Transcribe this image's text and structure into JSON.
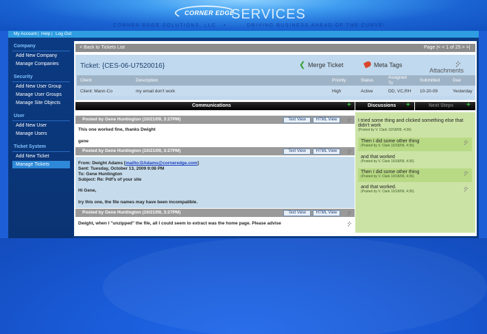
{
  "header": {
    "logo_small": "CORNER EDGE",
    "logo_big": "SERVICES",
    "tagline_left": "CORNER EDGE SOLUTIONS, LLC",
    "tagline_bullet": "•",
    "tagline_right": "DRIVING BUSINESS AHEAD OF THE CURVE!"
  },
  "topnav": {
    "my_account": "My Account",
    "sep": "|",
    "help": "Help",
    "logout": "Log Out"
  },
  "sidebar": {
    "company_head": "Company",
    "add_company": "Add New Company",
    "manage_companies": "Manage Companies",
    "security_head": "Security",
    "add_user_group": "Add New User Group",
    "manage_user_groups": "Manage User Groups",
    "manage_site_objects": "Manage Site Objects",
    "user_head": "User",
    "add_user": "Add New User",
    "manage_users": "Manage Users",
    "ticket_head": "Ticket System",
    "add_ticket": "Add New Ticket",
    "manage_tickets": "Manage Tickets"
  },
  "toolbar": {
    "back": "< Back to Tickets List",
    "pager": "Page |< < 1 of 25 > >|"
  },
  "ticket": {
    "title": "Ticket: {CES-06-U7520016}",
    "merge": "Merge Ticket",
    "meta_tags": "Meta Tags",
    "attachments": "Attachments",
    "columns": {
      "client": "Client",
      "description": "Description",
      "priority": "Priority",
      "status": "Status",
      "assigned_line1": "Assigned",
      "assigned_line2": "To",
      "submitted": "Submitted",
      "due": "Due"
    },
    "row": {
      "client": "Client: Mann-Co",
      "description": "my email don't work",
      "priority": "High",
      "status": "Active",
      "assigned": "DD, VC,RH",
      "submitted": "10-20-09",
      "due": "Yesterday"
    }
  },
  "communications": {
    "title": "Communications",
    "text_view": "Text View",
    "html_view": "HTML View",
    "posts": [
      {
        "by": "Posted by Gene Huntington (10/21/09, 3:27PM)",
        "lines": [
          "This one worked fine, thanks Dwight",
          "gene"
        ]
      },
      {
        "by": "Posted by Gene Huntington (10/21/09, 3:27PM)",
        "from_label": "From: Dwight Adams [",
        "from_link": "mailto:DAdams@corneredge.com",
        "from_end": "]",
        "sent": "Sent: Tuesday, October 13, 2009 9:08 PM",
        "to": "To: Gene Huntington",
        "subject": "Subject: Re: Pdf's of your site",
        "greeting": "Hi Gene,",
        "body": "try this one, the file names may have been incompatible."
      },
      {
        "by": "Posted by Gene Huntington (10/21/09, 3:27PM)",
        "body": "Dwight, when I \"unzipped\" the file, all I could seem to extract was the home page.  Please advise"
      }
    ]
  },
  "discussions": {
    "title": "Discussions",
    "next_steps": "Next Steps",
    "items": [
      {
        "text": "I tried some thing and clicked something else that didn't work",
        "by": "(Posted by V. Clark 10/18/09, 4:36)"
      },
      {
        "text": "Then I did some other thing",
        "by": "(Posted by V. Clark 10/18/09, 4:36)"
      },
      {
        "text": "and that worked",
        "by": "(Posted by V. Clark 10/18/09, 4:36)"
      },
      {
        "text": "Then I did some other thing",
        "by": "(Posted by V. Clark 10/18/09, 4:36)"
      },
      {
        "text": "and that worked.",
        "by": "(Posted by V. Clark 10/18/09, 4:36)"
      }
    ]
  },
  "colors": {
    "background_blue": "#1d5ed6",
    "nav_blue": "#2e9de2",
    "discussion_green": "#cce3a6",
    "plus_green": "#3cc43c"
  },
  "icons": [
    "paperclip-icon",
    "tag-icon",
    "merge-arrow-icon",
    "plus-icon"
  ]
}
